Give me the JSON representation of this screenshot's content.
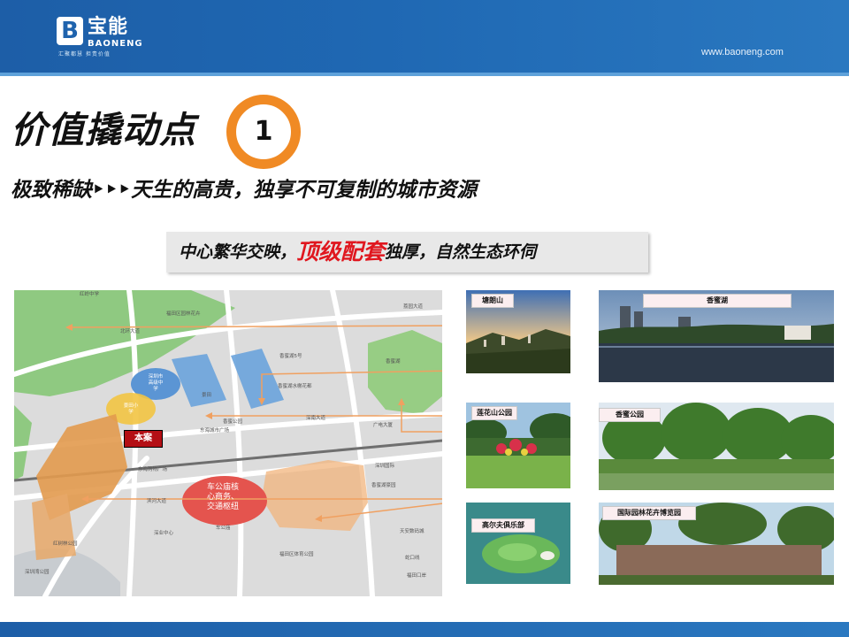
{
  "header": {
    "logo_glyph": "B",
    "brand_cn": "宝能",
    "brand_en": "BAONENG",
    "tagline": "汇聚都慧  担责价值",
    "site_url": "www.baoneng.com"
  },
  "title": "价值撬动点",
  "title_number": "1",
  "subtitle": "极致稀缺‣‣‣天生的高贵，独享不可复制的城市资源",
  "highlight": {
    "before": "中心繁华交映，",
    "emphasis": "顶级配套",
    "after": "独厚，自然生态环伺"
  },
  "map": {
    "project_label": "本案",
    "cbd_label": "车公庙核\n心商务、\n交通枢纽",
    "school_label_1": "深圳市\n高级中\n学",
    "school_label_2": "景田小\n学",
    "road_labels": [
      "红岭中学",
      "北环大道",
      "福田区园林花卉",
      "荔园大道",
      "香蜜湖5号",
      "香蜜湖水榭花都",
      "东海城市广场",
      "东海购物广场",
      "景田",
      "香蜜公园",
      "深南大道",
      "滨河大道",
      "福田区体育公园",
      "车公庙",
      "广电大厦",
      "深圳国际",
      "香蜜湖豪园",
      "天安数码城",
      "深业中心",
      "红树林公园",
      "深圳湾公园",
      "香蜜湖",
      "蛇口线",
      "福田口岸"
    ]
  },
  "photos": [
    {
      "label": "塘朗山"
    },
    {
      "label": "香蜜湖"
    },
    {
      "label": "莲花山公园"
    },
    {
      "label": "香蜜公园"
    },
    {
      "label": "高尔夫俱乐部"
    },
    {
      "label": "国际园林花卉博览园"
    }
  ],
  "colors": {
    "brand_blue": "#1f63ad",
    "ring_orange": "#f08a24",
    "emphasis_red": "#e0171f",
    "arrow_orange": "#f0a060",
    "site_red": "#b40f15"
  }
}
